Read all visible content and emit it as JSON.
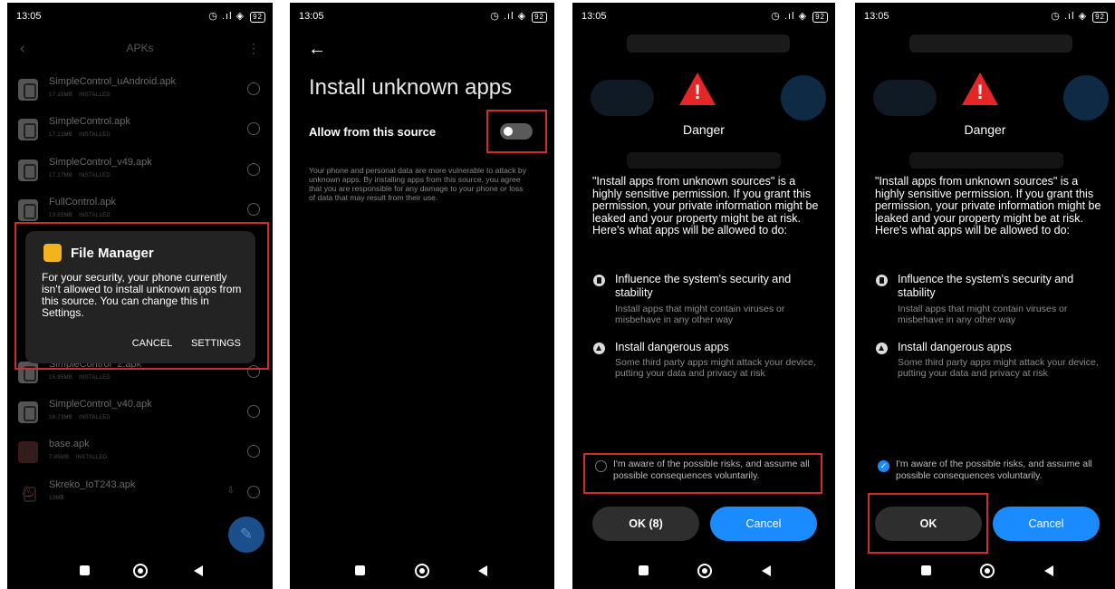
{
  "status": {
    "time": "13:05",
    "battery": "92",
    "indicators": "▸ ▷",
    "right_icons": "◷ .ıl ◈"
  },
  "panel1": {
    "title": "APKs",
    "files": [
      {
        "name": "SimpleControl_uAndroid.apk",
        "size": "17.15MB",
        "state": "INSTALLED"
      },
      {
        "name": "SimpleControl.apk",
        "size": "17.13MB",
        "state": "INSTALLED"
      },
      {
        "name": "SimpleControl_v49.apk",
        "size": "17.17MB",
        "state": "INSTALLED"
      },
      {
        "name": "FullControl.apk",
        "size": "13.65MB",
        "state": "INSTALLED"
      },
      {
        "name": "SimpleControl_2.apk",
        "size": "15.95MB",
        "state": "INSTALLED"
      },
      {
        "name": "SimpleControl_v40.apk",
        "size": "16.73MB",
        "state": "INSTALLED"
      },
      {
        "name": "base.apk",
        "size": "7.85MB",
        "state": "INSTALLED"
      },
      {
        "name": "Skreko_IoT243.apk",
        "size": "13MB",
        "state": ""
      }
    ],
    "dialog": {
      "title": "File Manager",
      "body": "For your security, your phone currently isn't allowed to install unknown apps from this source. You can change this in Settings.",
      "cancel": "CANCEL",
      "settings": "SETTINGS"
    }
  },
  "panel2": {
    "title": "Install unknown apps",
    "toggle_label": "Allow from this source",
    "toggle_on": false,
    "description": "Your phone and personal data are more vulnerable to attack by unknown apps. By installing apps from this source, you agree that you are responsible for any damage to your phone or loss of data that may result from their use."
  },
  "danger": {
    "title": "Danger",
    "body": "\"Install apps from unknown sources\" is a highly sensitive permission. If you grant this permission, your private information might be leaked and your property might be at risk. Here's what apps will be allowed to do:",
    "perm1_title": "Influence the system's security and stability",
    "perm1_desc": "Install apps that might contain viruses or misbehave in any other way",
    "perm2_title": "Install dangerous apps",
    "perm2_desc": "Some third party apps might attack your device, putting your data and privacy at risk",
    "aware_text": "I'm aware of the possible risks, and assume all possible consequences voluntarily.",
    "ok_countdown": "OK (8)",
    "ok": "OK",
    "cancel": "Cancel"
  },
  "colors": {
    "accent": "#1a8cff",
    "danger": "#e52526",
    "highlight": "#cf2d2d",
    "folder": "#f2b31c"
  }
}
